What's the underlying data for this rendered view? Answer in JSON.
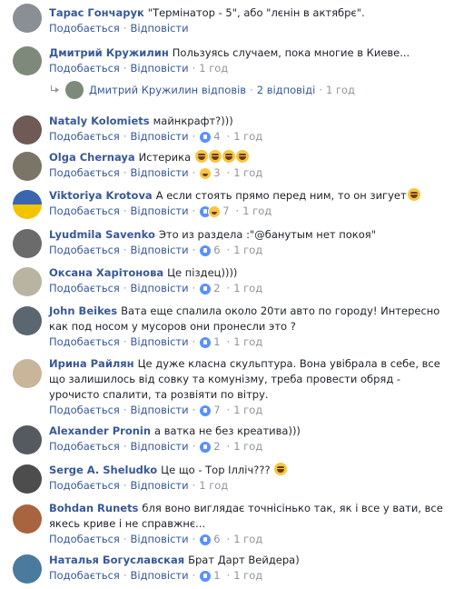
{
  "like_label": "Подобається",
  "reply_label": "Відповісти",
  "dot": "·",
  "comments": [
    {
      "author": "Тарас Гончарук",
      "text": "\"Термінатор - 5\", або \"лєнін в актябрє\".",
      "reactions": "",
      "count": "",
      "time": "",
      "avatar": "#8a8f96"
    },
    {
      "author": "Дмитрий Кружилин",
      "text": "Пользуясь случаем, пока многие в Киеве...",
      "reactions": "",
      "count": "",
      "time": "1 год",
      "avatar": "#7d8a7a"
    },
    {
      "author": "Nataly Kolomiets",
      "text": "майнкрафт?)))",
      "reactions": "like",
      "count": "4",
      "time": "1 год",
      "avatar": "#6f5a55"
    },
    {
      "author": "Olga Chernaya",
      "text": "Истерика",
      "reactions": "haha",
      "count": "3",
      "time": "1 год",
      "avatar": "#7a7566",
      "emojis": 4
    },
    {
      "author": "Viktoriya Krotova",
      "text": "А если стоять прямо перед ним, то он зигует",
      "reactions": "like,haha",
      "count": "7",
      "time": "1 год",
      "avatar": "#3a66b0",
      "emojis": 1
    },
    {
      "author": "Lyudmila Savenko",
      "text": "Это из раздела :\"@банутым нет покоя\"",
      "reactions": "like",
      "count": "6",
      "time": "1 год",
      "avatar": "#6b6b6b"
    },
    {
      "author": "Оксана Харітонова",
      "text": "Це пiздец))))",
      "reactions": "",
      "count": "",
      "time": "",
      "avatar": "#b9b4a2"
    },
    {
      "author": "John Beikes",
      "text": "Вата еще спалила около 20ти авто по городу! Интересно как под носом у мусоров они пронесли это ?",
      "reactions": "like",
      "count": "1",
      "time": "1 год",
      "avatar": "#5a6670"
    },
    {
      "author": "Ирина Райлян",
      "text": "Це дуже класна скульптура. Вона увібрала в себе, все що залишилось від совку та комунізму, треба провести обряд - урочисто спалити, та розвіяти по вітру.",
      "reactions": "like",
      "count": "7",
      "time": "1 год",
      "avatar": "#c9b59a"
    },
    {
      "author": "Alexander Pronin",
      "text": "а ватка не без креатива)))",
      "reactions": "like",
      "count": "2",
      "time": "1 год",
      "avatar": "#555a60"
    },
    {
      "author": "Serge A. Sheludko",
      "text": "Це що - Тор Ілліч???",
      "reactions": "",
      "count": "",
      "time": "1 год",
      "avatar": "#4d4d4d",
      "emojis": 1
    },
    {
      "author": "Bohdan Runets",
      "text": "бля воно виглядає точнісінько так, як і все у вати, все якесь криве і не справжнє...",
      "reactions": "like",
      "count": "6",
      "time": "1 год",
      "avatar": "#a8643f"
    },
    {
      "author": "Наталья Богуславская",
      "text": "Брат Дарт Вейдера)",
      "reactions": "like",
      "count": "1",
      "time": "1 год",
      "avatar": "#4a7a9e"
    }
  ],
  "reply_thread": {
    "author": "Дмитрий Кружилин",
    "verb": "відповів",
    "replies": "2 відповіді",
    "time": "1 год"
  }
}
